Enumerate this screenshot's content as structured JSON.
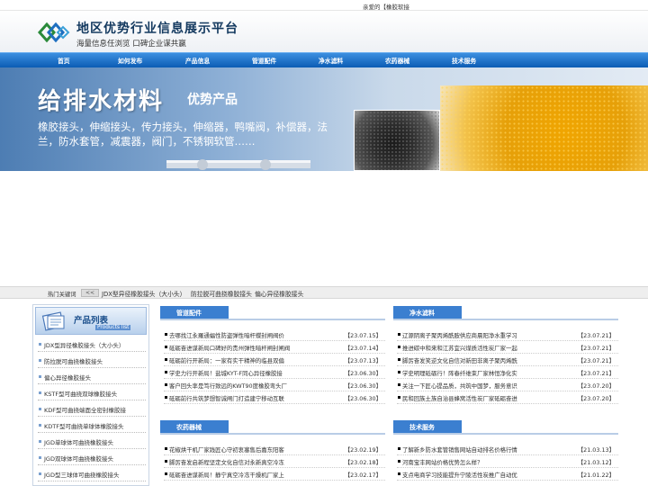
{
  "topbar": {
    "greeting": "亲爱的【橡胶软接"
  },
  "header": {
    "title": "地区优势行业信息展示平台",
    "slogan": "海量信息任浏览 口碑企业谋共赢"
  },
  "nav": {
    "items": [
      "首页",
      "如何发布",
      "产品信息",
      "管道配件",
      "净水滤料",
      "农药器械",
      "技术服务"
    ]
  },
  "banner": {
    "title": "给排水材料",
    "subtitle": "优势产品",
    "text": "橡胶接头，伸缩接头，传力接头，伸缩器，鸭嘴阀，补偿器，法兰，防水套管，减震器，阀门，不锈钢软管……"
  },
  "hotbar": {
    "label": "热门关键词",
    "arrow": "<<",
    "links": [
      "JDX型异径橡胶接头（大小头）",
      "防拉脱可曲挠橡胶接头",
      "偏心异径橡胶接头"
    ]
  },
  "sidebar": {
    "title": "产品列表",
    "subtitle": "Products list",
    "items": [
      "JDX型异径橡胶接头（大小头）",
      "防拉脱可曲挠橡胶接头",
      "偏心异径橡胶接头",
      "KSTF型可曲挠双球橡胶接头",
      "KDF型可曲挠端面全密封橡胶接",
      "KDTF型可曲挠单球体橡胶接头",
      "JGD单球体可曲挠橡胶接头",
      "JGD双球体可曲挠橡胶接头",
      "JGD型三球体可曲挠橡胶接头"
    ]
  },
  "panels": [
    {
      "name": "管道配件",
      "rows": [
        {
          "title": "去哪找江永羅通蝠性防盗弹性暗杆蝶封闸阀价",
          "date": "【23.07.15】"
        },
        {
          "title": "砥砺奋进谋新局口碑好的贵州弹性暗杆闸封闸阀",
          "date": "【23.07.14】"
        },
        {
          "title": "砥砺前行开新局：一家有实干精神的临县双偏",
          "date": "【23.07.13】"
        },
        {
          "title": "学史力行开新局！盐城KYT-F同心异径橡胶接",
          "date": "【23.06.30】"
        },
        {
          "title": "客户回头率是笃行致远的KWT90度橡胶弯头厂",
          "date": "【23.06.30】"
        },
        {
          "title": "砥砺前行共筑梦想智诚闸门打造建宁移动互联",
          "date": "【23.06.30】"
        }
      ]
    },
    {
      "name": "净水滤料",
      "rows": [
        {
          "title": "辽源阴离子聚丙烯酰胺供应商晨阳净水重学习",
          "date": "【23.07.21】"
        },
        {
          "title": "推进碳中和来和江苏宜兴煤质活性炭厂家一起",
          "date": "【23.07.21】"
        },
        {
          "title": "脚厉奋发笑逆文化自信对新田非离子聚丙烯酰",
          "date": "【23.07.21】"
        },
        {
          "title": "学史明理砥砺行！阵春纤维束厂家林恒净化实",
          "date": "【23.07.21】"
        },
        {
          "title": "关注一下匠心提品质，共筑中国梦，服务意识",
          "date": "【23.07.20】"
        },
        {
          "title": "民和回族土族自治县蜂窝活性炭厂家砥砺奋进",
          "date": "【23.07.20】"
        }
      ]
    },
    {
      "name": "农药器械",
      "rows": [
        {
          "title": "花椒烘干机厂家践匠心守初衷塞售后嘉东阳客",
          "date": "【23.02.19】"
        },
        {
          "title": "脚厉奋发启新程坚定文化自信对永新真空冷冻",
          "date": "【23.02.18】"
        },
        {
          "title": "砥砺奋进谋新局！静宁真空冷冻干燥机厂家上",
          "date": "【23.02.17】"
        }
      ]
    },
    {
      "name": "技术服务",
      "rows": [
        {
          "title": "了解新乡防水套管销售网站自动排名价格行情",
          "date": "【21.03.13】"
        },
        {
          "title": "河南宝丰网站价格优势怎么样？",
          "date": "【21.03.12】"
        },
        {
          "title": "支点电商学习技能提升宁陵活性炭推广自动优",
          "date": "【21.01.22】"
        }
      ]
    }
  ],
  "colors": {
    "nav": "#1a6fc9",
    "panelTag": "#3b7fd0",
    "banner": "#6f97c6"
  }
}
